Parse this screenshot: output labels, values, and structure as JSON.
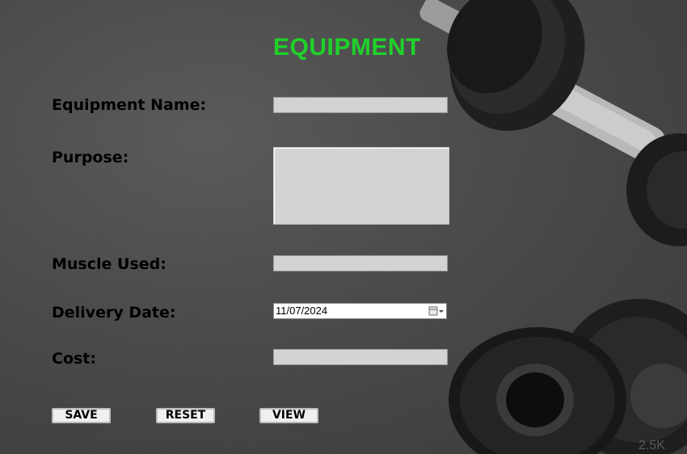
{
  "form": {
    "title": "EQUIPMENT",
    "labels": {
      "equipment_name": "Equipment Name:",
      "purpose": "Purpose:",
      "muscle_used": "Muscle Used:",
      "delivery_date": "Delivery Date:",
      "cost": "Cost:"
    },
    "values": {
      "equipment_name": "",
      "purpose": "",
      "muscle_used": "",
      "delivery_date": "11/07/2024",
      "cost": ""
    },
    "buttons": {
      "save": "SAVE",
      "reset": "RESET",
      "view": "VIEW"
    }
  },
  "colors": {
    "title": "#1fd12a",
    "field_bg": "#d3d3d3"
  },
  "background": {
    "plate_marking": "2.5K"
  }
}
